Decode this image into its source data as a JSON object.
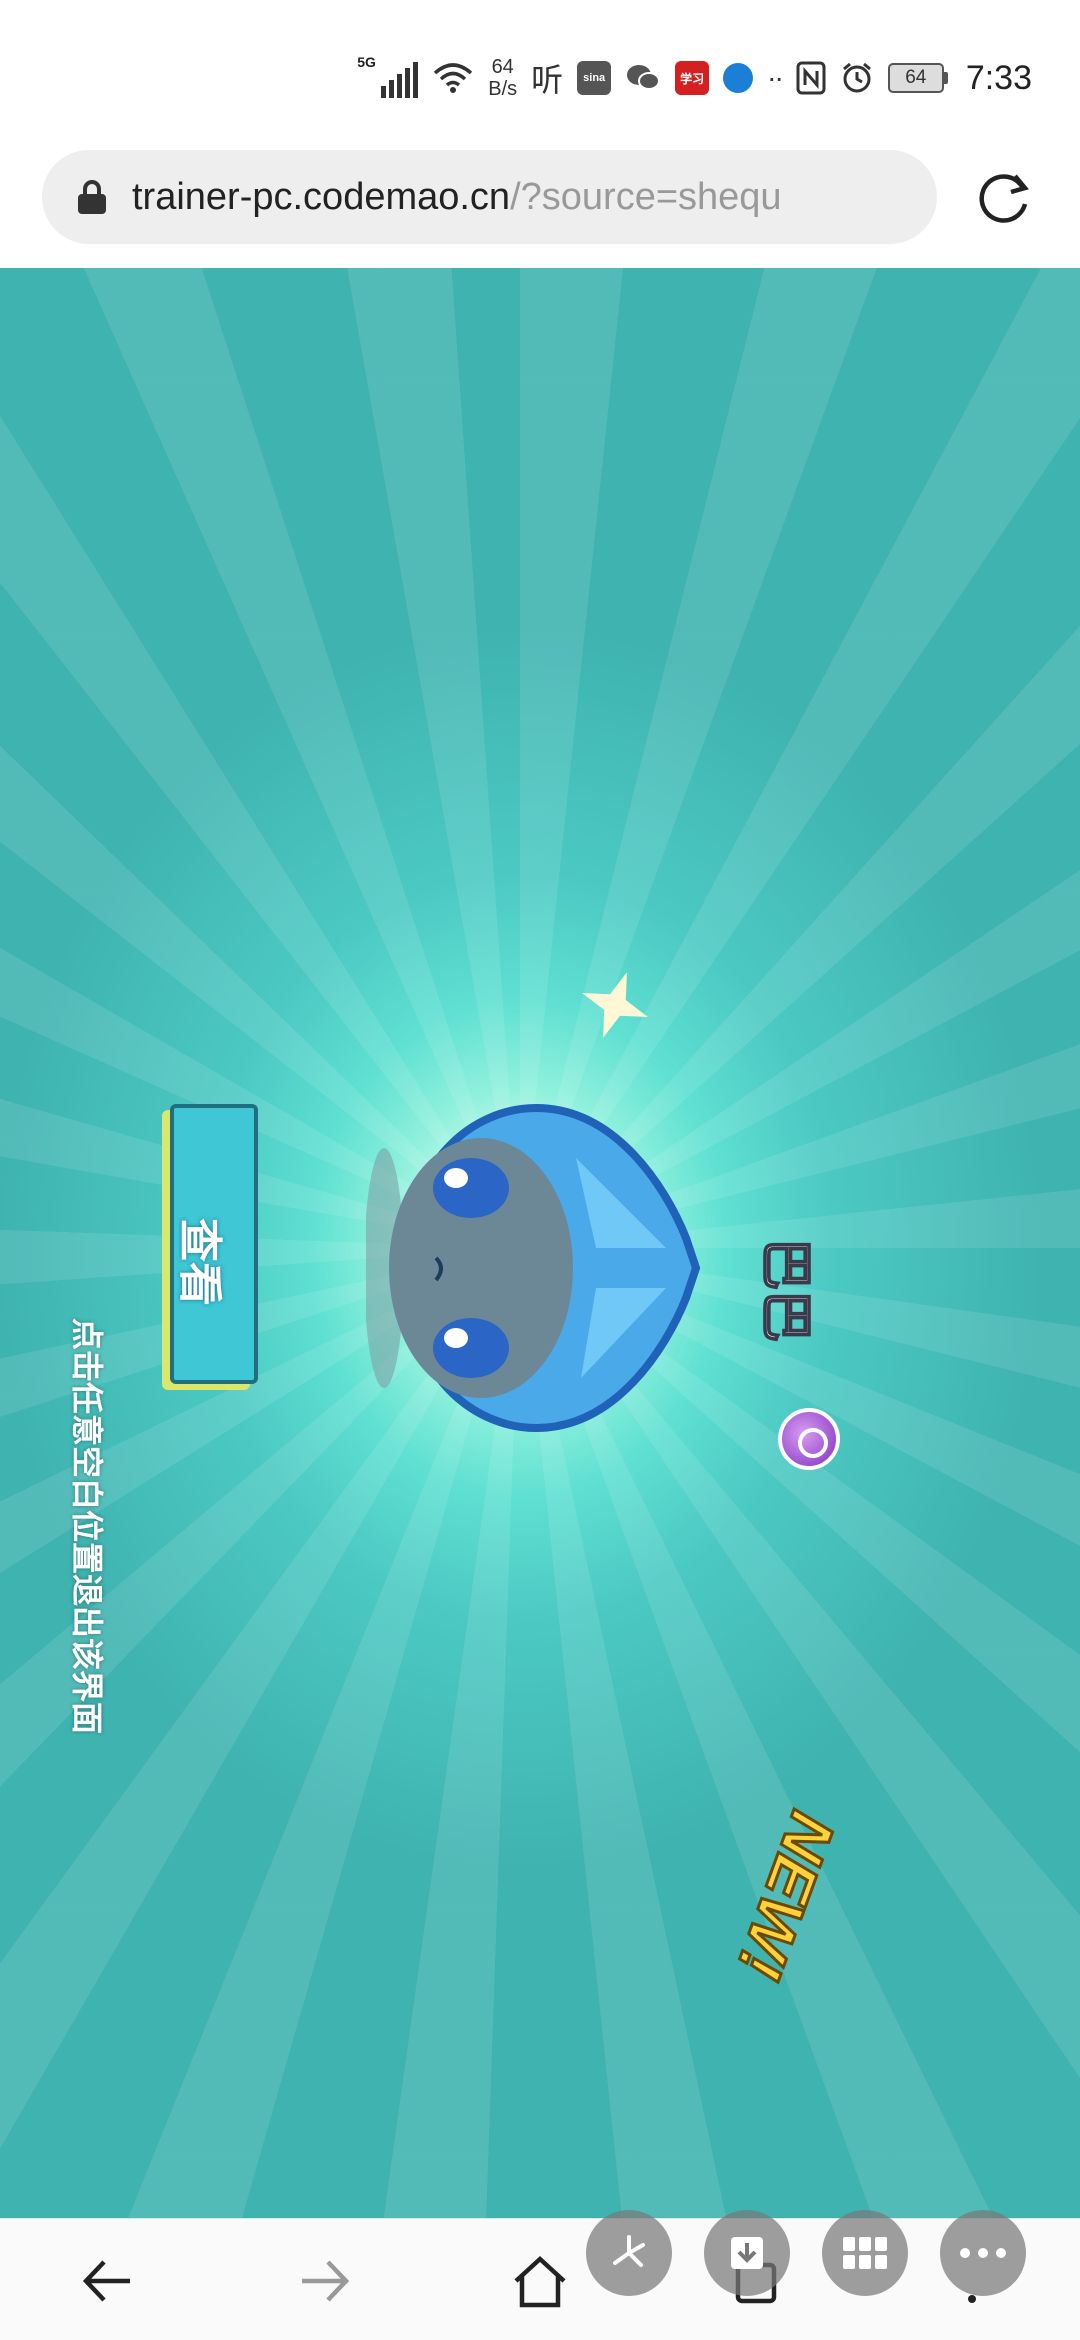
{
  "status_bar": {
    "network": "5G",
    "net_speed_value": "64",
    "net_speed_unit": "B/s",
    "listen_icon_text": "听",
    "sina_icon_text": "sina",
    "study_icon_text": "学习",
    "battery": "64",
    "time": "7:33",
    "icons": [
      "signal-icon",
      "wifi-icon",
      "listen-app-icon",
      "sina-icon",
      "wechat-icon",
      "study-app-icon",
      "browser-app-icon",
      "more-dots-icon",
      "nfc-icon",
      "alarm-icon",
      "battery-icon"
    ]
  },
  "address_bar": {
    "host": "trainer-pc.codemao.cn",
    "path": "/?source=shequ"
  },
  "game": {
    "hint": "点击任意空白位置退出该界面",
    "view_button": "查看",
    "character_name": "巴巴",
    "new_tag": "NEW!"
  },
  "nav": {
    "icons": [
      "back-icon",
      "forward-icon",
      "home-icon",
      "tabs-icon",
      "more-icon"
    ],
    "floating": [
      "pinwheel-icon",
      "download-icon",
      "grid-icon",
      "ellipsis-icon"
    ]
  },
  "colors": {
    "game_bg": "#4cc9c3",
    "button_bg": "#3fc7d6",
    "new_tag": "#ffd23a",
    "badge": "#9b4fcf"
  }
}
